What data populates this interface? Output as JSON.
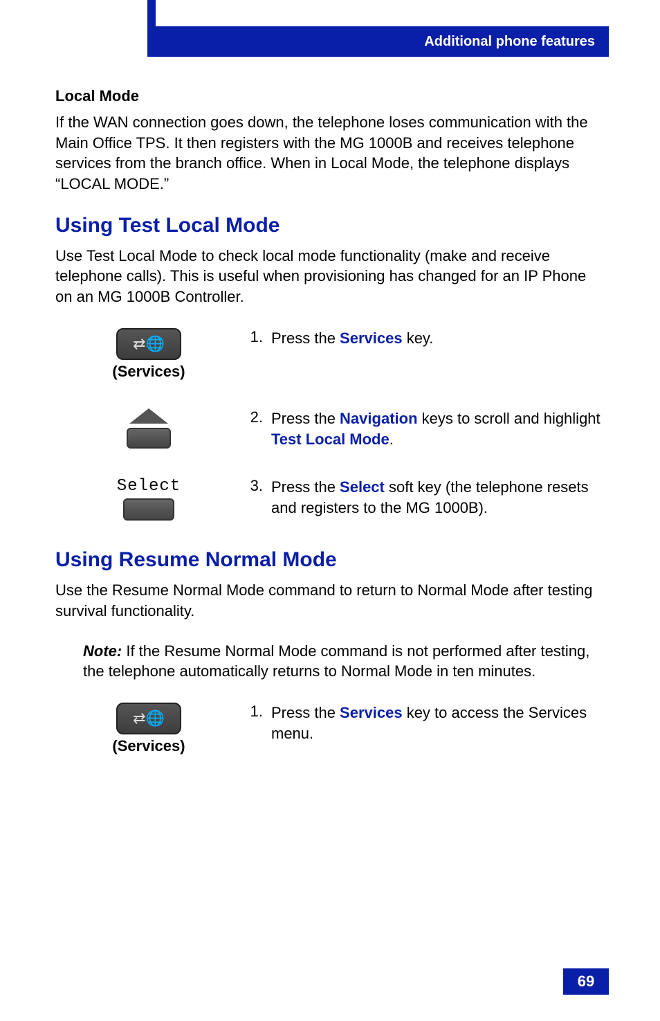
{
  "header": {
    "title": "Additional phone features"
  },
  "local_mode": {
    "heading": "Local Mode",
    "paragraph": "If the WAN connection goes down, the telephone loses communication with the Main Office TPS. It then registers with the MG 1000B and receives telephone services from the branch office. When in Local Mode, the telephone displays “LOCAL MODE.”"
  },
  "section1": {
    "title": "Using Test Local Mode",
    "intro": "Use Test Local Mode to check local mode functionality (make and receive telephone calls). This is useful when provisioning has changed for an IP Phone on an MG 1000B Controller.",
    "steps": [
      {
        "num": "1.",
        "icon_caption": "(Services)",
        "pre": "Press the ",
        "kw": "Services",
        "post": " key."
      },
      {
        "num": "2.",
        "pre": "Press the ",
        "kw": "Navigation",
        "mid": " keys to scroll and highlight ",
        "kw2": "Test Local Mode",
        "post2": "."
      },
      {
        "num": "3.",
        "soft_label": "Select",
        "pre": "Press the ",
        "kw": "Select",
        "post": " soft key (the telephone resets and registers to the MG 1000B)."
      }
    ]
  },
  "section2": {
    "title": "Using Resume Normal Mode",
    "intro": "Use the Resume Normal Mode command to return to Normal Mode after testing survival functionality.",
    "note_label": "Note:",
    "note_text": " If the Resume Normal Mode command is not performed after testing, the telephone automatically returns to Normal Mode in ten minutes.",
    "steps": [
      {
        "num": "1.",
        "icon_caption": "(Services)",
        "pre": "Press the ",
        "kw": "Services",
        "post": " key to access the Services menu."
      }
    ]
  },
  "page_number": "69"
}
